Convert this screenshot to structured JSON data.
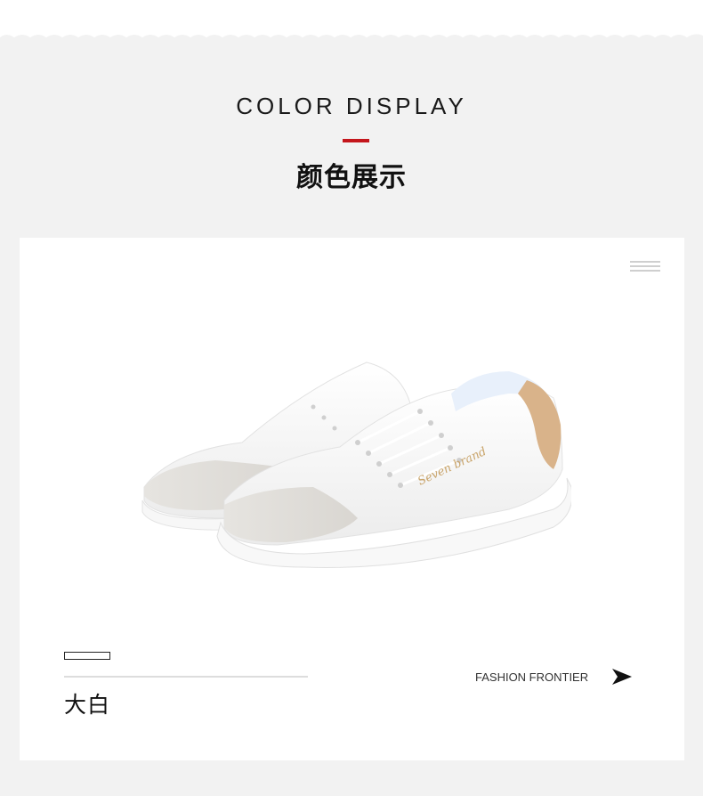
{
  "header": {
    "title_en": "COLOR DISPLAY",
    "title_cn": "颜色展示",
    "accent_color": "#c4161c"
  },
  "card": {
    "color_name": "大白",
    "tagline": "FASHION FRONTIER",
    "icons": [
      "menu-lines-icon",
      "arrow-right-icon"
    ],
    "shoe_brand_script": "Seven brand"
  }
}
